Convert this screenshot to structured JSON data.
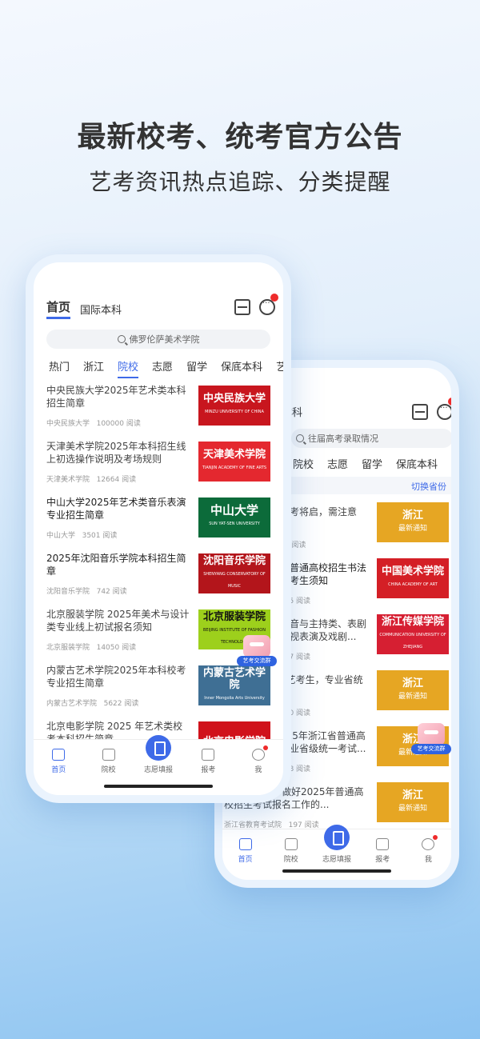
{
  "headline": "最新校考、统考官方公告",
  "subline": "艺考资讯热点追踪、分类提醒",
  "front": {
    "top_tabs": [
      "首页",
      "国际本科"
    ],
    "search_placeholder": "佛罗伦萨美术学院",
    "categories": [
      "热门",
      "浙江",
      "院校",
      "志愿",
      "留学",
      "保底本科",
      "艺考"
    ],
    "active_category": "院校",
    "news": [
      {
        "title": "中央民族大学2025年艺术类本科招生简章",
        "source": "中央民族大学",
        "reads": "100000 阅读",
        "thumb": "中央民族大学",
        "thumb_sub": "MINZU UNIVERSITY OF CHINA",
        "thumb_color": "#c8161e"
      },
      {
        "title": "天津美术学院2025年本科招生线上初选操作说明及考场规则",
        "source": "天津美术学院",
        "reads": "12664 阅读",
        "thumb": "天津美术学院",
        "thumb_sub": "TIANJIN ACADEMY OF FINE ARTS",
        "thumb_color": "#e4282f"
      },
      {
        "title": "中山大学2025年艺术类音乐表演专业招生简章",
        "source": "中山大学",
        "reads": "3501 阅读",
        "thumb": "中山大学",
        "thumb_sub": "SUN YAT-SEN UNIVERSITY",
        "thumb_color": "#0c6b3a"
      },
      {
        "title": "2025年沈阳音乐学院本科招生简章",
        "source": "沈阳音乐学院",
        "reads": "742 阅读",
        "thumb": "沈阳音乐学院",
        "thumb_sub": "SHENYANG CONSERVATORY OF MUSIC",
        "thumb_color": "#b3151b"
      },
      {
        "title": "北京服装学院  2025年美术与设计类专业线上初试报名须知",
        "source": "北京服装学院",
        "reads": "14050 阅读",
        "thumb": "北京服装学院",
        "thumb_sub": "BEIJING INSTITUTE OF FASHION TECHNOLOGY",
        "thumb_color": "#9dd01c",
        "thumb_text_color": "#111"
      },
      {
        "title": "内蒙古艺术学院2025年本科校考专业招生简章",
        "source": "内蒙古艺术学院",
        "reads": "5622 阅读",
        "thumb": "内蒙古艺术学院",
        "thumb_sub": "Inner Mongolia Arts University",
        "thumb_color": "#3f6f94"
      },
      {
        "title": "北京电影学院 2025 年艺术类校考本科招生简章",
        "source": "",
        "reads": "",
        "thumb": "北京电影学院",
        "thumb_sub": "",
        "thumb_color": "#d0121b"
      }
    ],
    "badge_label": "艺考交流群"
  },
  "back": {
    "top_tab": "本科",
    "search_placeholder": "往届高考录取情况",
    "categories": [
      "院校",
      "志愿",
      "留学",
      "保底本科",
      "艺考"
    ],
    "switch_label": "切换省份",
    "news": [
      {
        "title": "统考将启，需注意",
        "source": "",
        "reads": "96 阅读",
        "thumb": "浙江",
        "thumb2": "最新通知",
        "thumb_color": "#e6a623"
      },
      {
        "title": "省普通高校招生书法试考生须知",
        "source": "",
        "reads": "725 阅读",
        "thumb": "中国美术学院",
        "thumb2": "CHINA ACADEMY OF ART",
        "thumb_color": "#d41f26"
      },
      {
        "title": "播音与主持类、表剧影视表演及戏剧...",
        "source": "",
        "reads": "847 阅读",
        "thumb": "浙江传媒学院",
        "thumb2": "COMMUNICATION UNIVERSITY OF ZHEJIANG",
        "thumb_color": "#d61f32"
      },
      {
        "title": "5艺考生，专业省统",
        "source": "",
        "reads": "140 阅读",
        "thumb": "浙江",
        "thumb2": "最新通知",
        "thumb_color": "#e6a623"
      },
      {
        "title": "025年浙江省普通高专业省级统一考试...",
        "source": "",
        "reads": "398 阅读",
        "thumb": "浙江",
        "thumb2": "最新通知",
        "thumb_color": "#e6a623"
      },
      {
        "title": "，考试院关于做好2025年普通高校招生考试报名工作的...",
        "source": "浙江省教育考试院",
        "reads": "197 阅读",
        "thumb": "浙江",
        "thumb2": "最新通知",
        "thumb_color": "#e6a623"
      }
    ],
    "badge_label": "艺考交流群"
  },
  "tabbar": [
    {
      "label": "首页",
      "icon": "home-icon",
      "active": true
    },
    {
      "label": "院校",
      "icon": "school-icon"
    },
    {
      "label": "志愿填报",
      "icon": "form-icon",
      "center": true
    },
    {
      "label": "报考",
      "icon": "apply-icon"
    },
    {
      "label": "我",
      "icon": "profile-icon",
      "dot": true
    }
  ],
  "colors": {
    "accent": "#3e6ae8",
    "badge_red": "#ee2b2b"
  }
}
